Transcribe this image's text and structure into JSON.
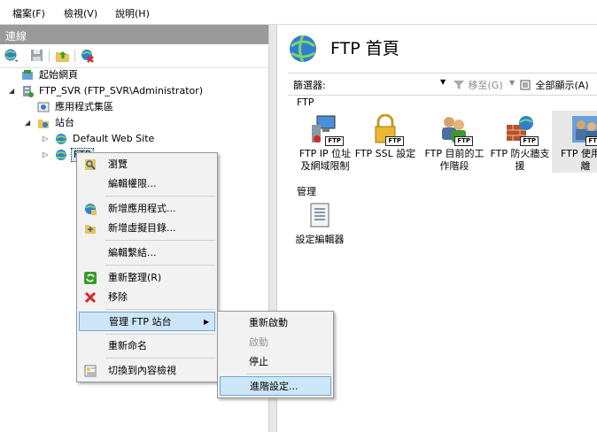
{
  "menubar": {
    "file": "檔案(F)",
    "view": "檢視(V)",
    "help": "說明(H)"
  },
  "connections": {
    "title": "連線",
    "toolbar_icons": [
      "connect-globe-icon",
      "save-icon",
      "up-folder-icon",
      "disconnect-icon"
    ],
    "tree": {
      "start_page": "起始網頁",
      "server": "FTP_SVR (FTP_SVR\\Administrator)",
      "app_pools": "應用程式集區",
      "sites": "站台",
      "default_site": "Default Web Site",
      "ftp_site": "FTP"
    }
  },
  "right": {
    "title": "FTP 首頁",
    "filter_label": "篩選器:",
    "go_button": "移至(G)",
    "show_all": "全部顯示(A)",
    "group_ftp": "FTP",
    "group_manage": "管理",
    "features": [
      {
        "line1": "FTP IP 位址",
        "line2": "及網域限制"
      },
      {
        "line1": "FTP SSL 設定",
        "line2": ""
      },
      {
        "line1": "FTP 目前的工",
        "line2": "作階段"
      },
      {
        "line1": "FTP 防火牆支",
        "line2": "援"
      },
      {
        "line1": "FTP 使用者",
        "line2": "離"
      }
    ],
    "manage_features": [
      {
        "line1": "設定編輯器"
      }
    ],
    "badge": "FTP"
  },
  "context_menu": {
    "items": {
      "browse": "瀏覽",
      "edit_permissions": "編輯權限...",
      "add_application": "新增應用程式...",
      "add_virtual_directory": "新增虛擬目錄...",
      "edit_bindings": "編輯繫結...",
      "refresh": "重新整理(R)",
      "remove": "移除",
      "manage_ftp_site": "管理 FTP 站台",
      "rename": "重新命名",
      "switch_content_view": "切換到內容檢視"
    }
  },
  "submenu": {
    "restart": "重新啟動",
    "start": "啟動",
    "stop": "停止",
    "advanced_settings": "進階設定..."
  },
  "colors": {
    "header_gray": "#9a9a9a",
    "selection_blue": "#cde6f7",
    "selection_border": "#6fa6d6",
    "globe_blue": "#2f7fd1",
    "remove_red": "#d8262b"
  }
}
